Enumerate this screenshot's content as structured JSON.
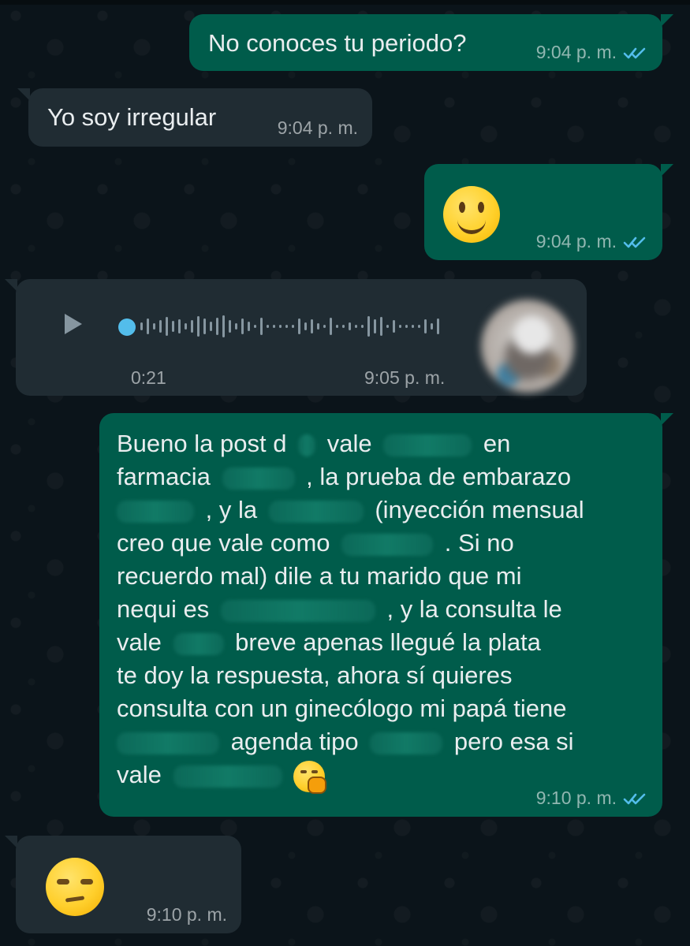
{
  "messages": [
    {
      "id": "m1",
      "direction": "outgoing",
      "text": "No conoces tu periodo?",
      "time": "9:04 p. m.",
      "status": "read"
    },
    {
      "id": "m2",
      "direction": "incoming",
      "text": "Yo soy irregular",
      "time": "9:04 p. m."
    },
    {
      "id": "m3",
      "direction": "outgoing",
      "emoji": "slightly-smiling-face-icon",
      "time": "9:04 p. m.",
      "status": "read"
    },
    {
      "id": "m4",
      "direction": "incoming",
      "type": "voice",
      "duration": "0:21",
      "time": "9:05 p. m."
    },
    {
      "id": "m5",
      "direction": "outgoing",
      "lines": [
        "Bueno la post d",
        "vale",
        "en",
        "farmacia",
        ", la prueba de embarazo",
        ", y la",
        "(inyección mensual",
        "creo que vale como",
        ". Si no",
        "recuerdo mal) dile a tu marido que mi",
        "nequi es",
        ", y la consulta le",
        "vale",
        "breve apenas llegué la plata",
        "te doy la respuesta, ahora sí quieres",
        "consulta con un ginecólogo mi papá tiene",
        "agenda tipo",
        "pero esa si",
        "vale"
      ],
      "emoji": "face-with-hand-over-mouth-icon",
      "time": "9:10 p. m.",
      "status": "read"
    },
    {
      "id": "m6",
      "direction": "incoming",
      "emoji": "unamused-face-icon",
      "time": "9:10 p. m."
    }
  ],
  "colors": {
    "background": "#0b141a",
    "outgoing_bubble": "#005c4b",
    "incoming_bubble": "#202c33",
    "text": "#e9edef",
    "meta_text": "#aebac1",
    "read_ticks": "#53bdeb"
  }
}
